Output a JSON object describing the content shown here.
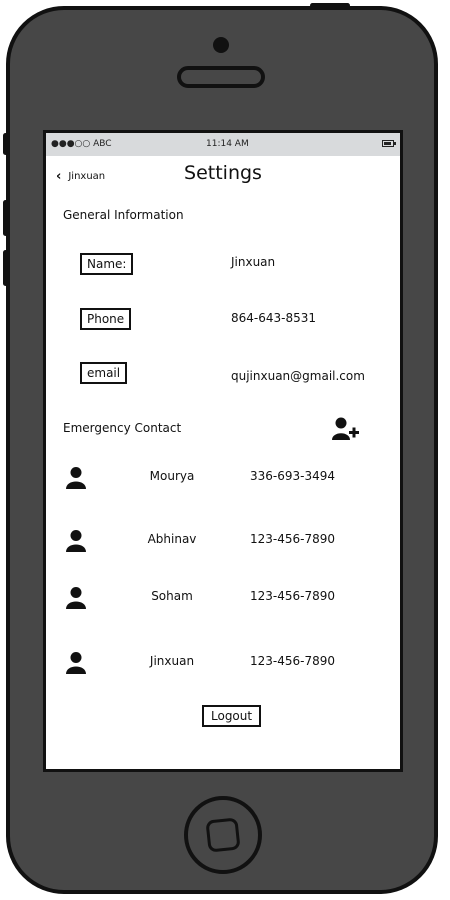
{
  "status_bar": {
    "signal": "●●●○○ ABC",
    "time": "11:14 AM"
  },
  "nav": {
    "back_label": "Jinxuan",
    "title": "Settings"
  },
  "general": {
    "heading": "General Information",
    "fields": [
      {
        "label": "Name:",
        "value": "Jinxuan"
      },
      {
        "label": "Phone",
        "value": "864-643-8531"
      },
      {
        "label": "email",
        "value": "qujinxuan@gmail.com"
      }
    ]
  },
  "emergency": {
    "heading": "Emergency Contact",
    "contacts": [
      {
        "name": "Mourya",
        "phone": "336-693-3494"
      },
      {
        "name": "Abhinav",
        "phone": "123-456-7890"
      },
      {
        "name": "Soham",
        "phone": "123-456-7890"
      },
      {
        "name": "Jinxuan",
        "phone": "123-456-7890"
      }
    ]
  },
  "logout_label": "Logout",
  "icons": {
    "back": "chevron-left-icon",
    "add_contact": "add-user-icon",
    "contact": "user-icon",
    "battery": "battery-icon"
  }
}
